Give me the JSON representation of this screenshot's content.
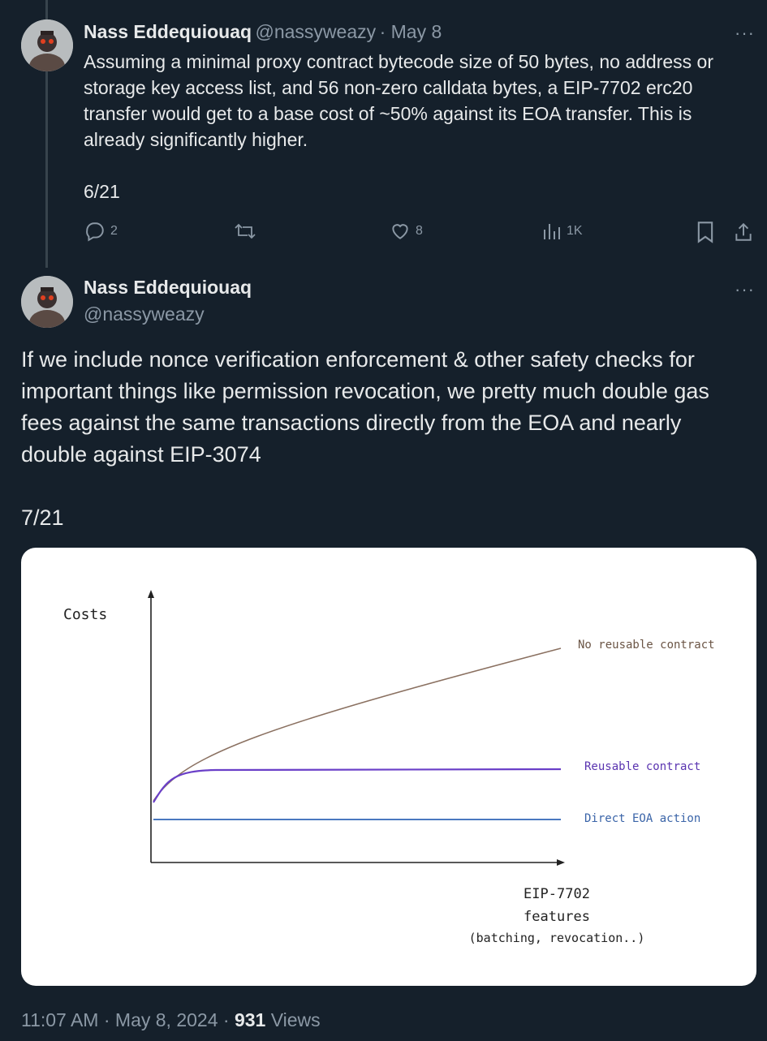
{
  "tweet1": {
    "name": "Nass Eddequiouaq",
    "handle": "@nassyweazy",
    "date": "· May 8",
    "text": "Assuming a minimal proxy contract bytecode size of 50 bytes, no address or storage key access list, and 56 non-zero calldata bytes, a EIP-7702 erc20 transfer would get to a base cost of ~50% against its EOA transfer. This is already significantly higher.",
    "counter": "6/21",
    "replies": "2",
    "likes": "8",
    "views": "1K",
    "more": "···"
  },
  "tweet2": {
    "name": "Nass Eddequiouaq",
    "handle": "@nassyweazy",
    "text": "If we include nonce verification enforcement & other safety checks for important things like permission revocation, we pretty much double gas fees against the same transactions directly from the EOA and nearly double against EIP-3074",
    "counter": "7/21",
    "more": "···",
    "time": "11:07 AM · May 8, 2024 · ",
    "views_count": "931",
    "views_label": " Views"
  },
  "chart_data": {
    "type": "line",
    "ylabel": "Costs",
    "xlabel_lines": [
      "EIP-7702",
      "features",
      "(batching, revocation..)"
    ],
    "series": [
      {
        "name": "No reusable contract",
        "color": "#8a7060",
        "shape": "concave-rising"
      },
      {
        "name": "Reusable contract",
        "color": "#6a3fc8",
        "shape": "rises-then-flat"
      },
      {
        "name": "Direct EOA action",
        "color": "#4a78c0",
        "shape": "flat-lowest"
      }
    ]
  }
}
